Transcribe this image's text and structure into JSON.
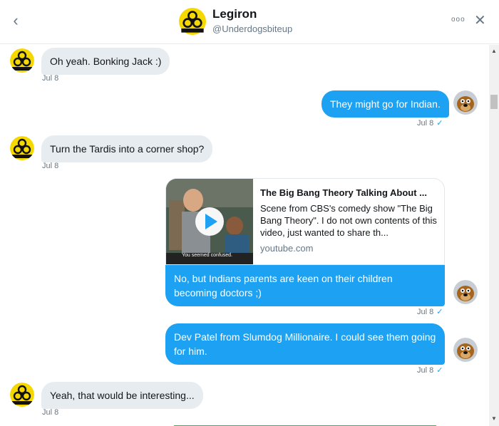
{
  "header": {
    "back_icon": "chevron-left-icon",
    "back_glyph": "‹",
    "name": "Legiron",
    "handle": "@Underdogsbiteup",
    "more_glyph": "ooo",
    "close_glyph": "✕"
  },
  "colors": {
    "accent": "#1da1f2",
    "incoming_bubble": "#e6ecf0",
    "secondary_text": "#657786",
    "biohazard_yellow": "#f5d800"
  },
  "messages": [
    {
      "direction": "in",
      "text": "Oh yeah. Bonking Jack :)",
      "time": "Jul 8"
    },
    {
      "direction": "out",
      "text": "They might go for Indian.",
      "time": "Jul 8",
      "check": "✓"
    },
    {
      "direction": "in",
      "text": "Turn the Tardis into a corner shop?",
      "time": "Jul 8"
    },
    {
      "direction": "out",
      "text": "No, but Indians parents are keen on their children becoming doctors ;)",
      "time": "Jul 8",
      "check": "✓"
    },
    {
      "direction": "out",
      "text": "Dev Patel from Slumdog Millionaire. I could see them going for him.",
      "time": "Jul 8",
      "check": "✓"
    },
    {
      "direction": "in",
      "text": "Yeah, that would be interesting...",
      "time": "Jul 8"
    }
  ],
  "link_card": {
    "title": "The Big Bang Theory Talking About ...",
    "description": "Scene from CBS's comedy show \"The Big Bang Theory\". I do not own contents of this video, just wanted to share th...",
    "domain": "youtube.com",
    "thumbnail_caption": "You seemed confused."
  },
  "scrollbar": {
    "up_glyph": "▲",
    "down_glyph": "▼"
  }
}
